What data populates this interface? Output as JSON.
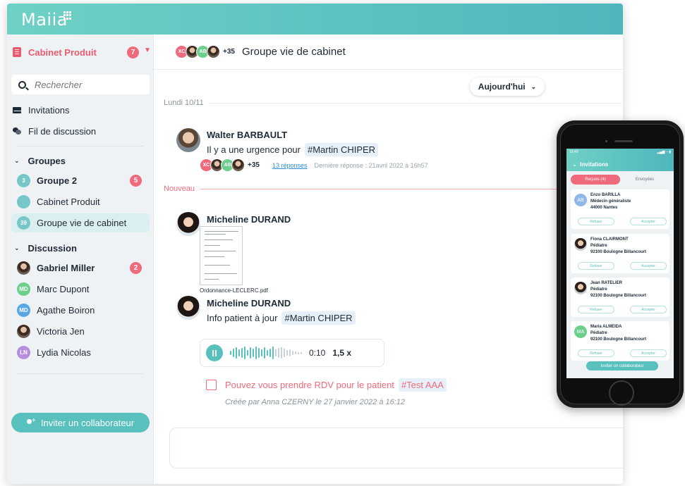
{
  "app": {
    "logo": "Maiia"
  },
  "sidebar": {
    "cabinet": {
      "label": "Cabinet Produit",
      "badge": "7"
    },
    "search": {
      "placeholder": "Rechercher"
    },
    "nav": [
      {
        "label": "Invitations"
      },
      {
        "label": "Fil de discussion"
      }
    ],
    "groups": {
      "title": "Groupes",
      "items": [
        {
          "avatar": "3",
          "label": "Groupe 2",
          "badge": "5"
        },
        {
          "avatar": "",
          "label": "Cabinet Produit"
        },
        {
          "avatar": "39",
          "label": "Groupe vie de cabinet"
        }
      ]
    },
    "discussion": {
      "title": "Discussion",
      "items": [
        {
          "avatar": "",
          "label": "Gabriel Miller",
          "badge": "2"
        },
        {
          "avatar": "MD",
          "label": "Marc Dupont"
        },
        {
          "avatar": "MD",
          "label": "Agathe Boiron"
        },
        {
          "avatar": "",
          "label": "Victoria Jen"
        },
        {
          "avatar": "LN",
          "label": "Lydia Nicolas"
        }
      ]
    },
    "invite_button": "Inviter un collaborateur"
  },
  "chat": {
    "header": {
      "members": [
        "XC",
        "",
        "AB",
        ""
      ],
      "more": "+35",
      "title": "Groupe vie de cabinet"
    },
    "date_filter": "Aujourd'hui",
    "day_label": "Lundi 10/11",
    "new_label": "Nouveau",
    "messages": [
      {
        "author": "Walter BARBAULT",
        "text": "Il y a une urgence pour",
        "tag": "#Martin CHIPER",
        "thread": {
          "members": [
            "XC",
            "",
            "AB",
            ""
          ],
          "more": "+35",
          "replies": "13 réponses",
          "last": "Dernière réponse : 21avril 2022 à 16h57"
        }
      },
      {
        "author": "Micheline DURAND",
        "attachment": "Ordonnance-LECLERC.pdf"
      },
      {
        "author": "Micheline DURAND",
        "text": "Info patient à jour",
        "tag": "#Martin CHIPER",
        "audio": {
          "time": "0:10",
          "speed": "1,5 x"
        }
      }
    ],
    "task": {
      "text": "Pouvez vous prendre RDV pour le patient",
      "tag": "#Test AAA",
      "meta": "Créée par Anna CZERNY le 27 janvier 2022 à 16:12"
    }
  },
  "phone": {
    "status_time": "16:40",
    "title": "Invitations",
    "tabs": [
      "Reçues (4)",
      "Envoyées"
    ],
    "cards": [
      {
        "avatar": "AB",
        "name": "Enzo BARILLA",
        "role": "Médecin généraliste",
        "city": "44000 Nantes"
      },
      {
        "avatar": "",
        "name": "Fiona CLAIRMONT",
        "role": "Pédiatre",
        "city": "92100 Boulogne Billancourt"
      },
      {
        "avatar": "",
        "name": "Jean RATELIER",
        "role": "Pédiatre",
        "city": "92100 Boulogne Billancourt"
      },
      {
        "avatar": "MA",
        "name": "Maria ALMEIDA",
        "role": "Pédiatre",
        "city": "92100 Boulogne Billancourt"
      }
    ],
    "refuse": "Refuser",
    "accept": "Accepter",
    "invite": "Inviter un collaborateur"
  },
  "colors": {
    "accent": "#58c0bd",
    "alert": "#ef6a7a",
    "link": "#2b8fd6"
  }
}
